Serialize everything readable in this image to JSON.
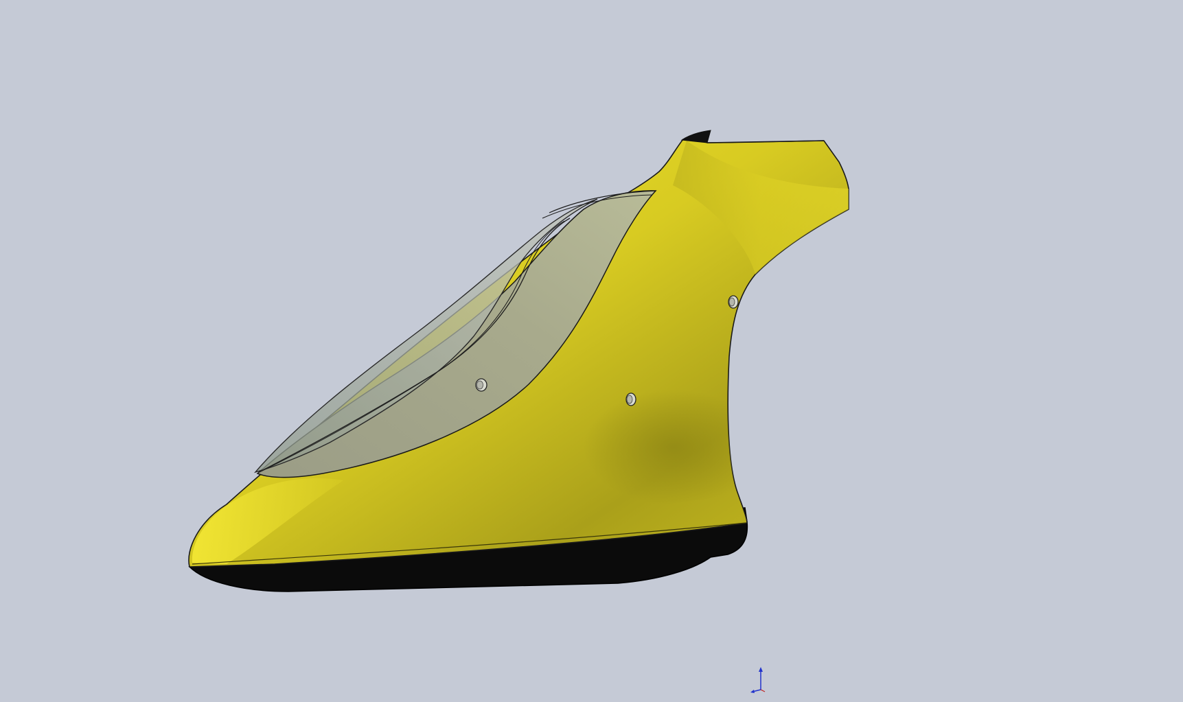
{
  "viewport": {
    "background": "#c5cad6"
  },
  "model": {
    "part": "helicopter-canopy-body",
    "body_color": "#e6d820",
    "body_shadow_color": "#9a9018",
    "underside_color": "#0b0b0b",
    "window_color": "#a6a893",
    "edge_color": "#1a1a1a",
    "mounting_holes": 3
  },
  "triad": {
    "icon": "axis-triad-icon",
    "y_axis_color": "#2233cc",
    "x_axis_color": "#2233cc"
  }
}
